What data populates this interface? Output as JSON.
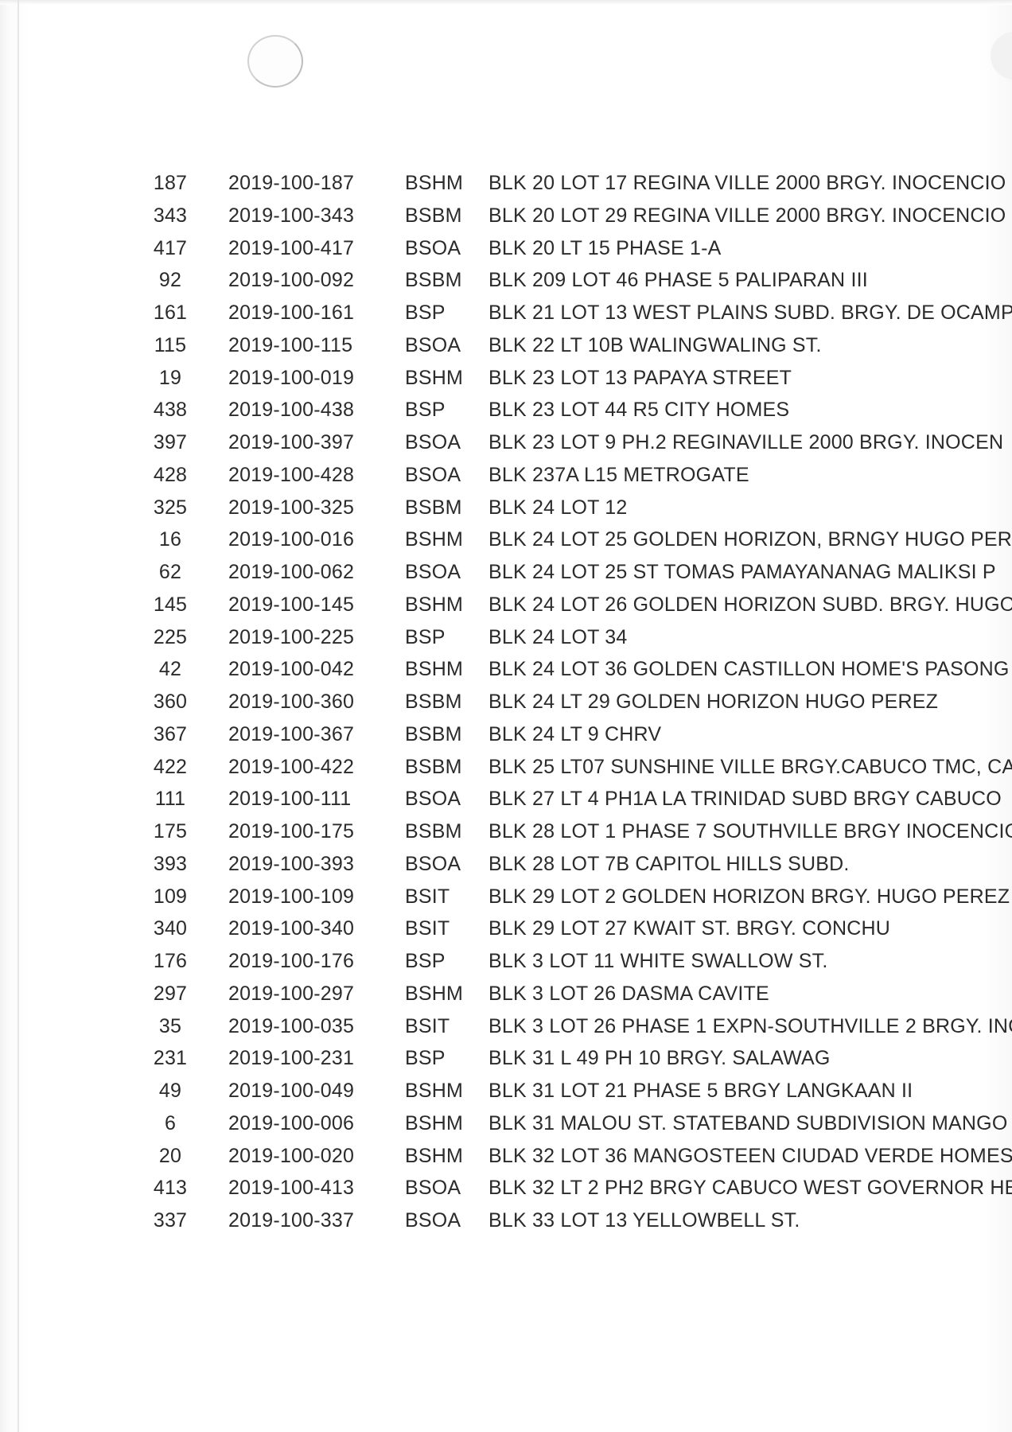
{
  "rows": [
    {
      "no": "187",
      "id": "2019-100-187",
      "program": "BSHM",
      "address": "BLK 20 LOT 17 REGINA VILLE 2000 BRGY. INOCENCIO"
    },
    {
      "no": "343",
      "id": "2019-100-343",
      "program": "BSBM",
      "address": "BLK 20 LOT 29 REGINA VILLE 2000 BRGY. INOCENCIO"
    },
    {
      "no": "417",
      "id": "2019-100-417",
      "program": "BSOA",
      "address": "BLK 20 LT 15 PHASE 1-A"
    },
    {
      "no": "92",
      "id": "2019-100-092",
      "program": "BSBM",
      "address": "BLK 209 LOT 46 PHASE 5 PALIPARAN III"
    },
    {
      "no": "161",
      "id": "2019-100-161",
      "program": "BSP",
      "address": "BLK 21 LOT 13 WEST PLAINS SUBD. BRGY. DE OCAMP"
    },
    {
      "no": "115",
      "id": "2019-100-115",
      "program": "BSOA",
      "address": "BLK 22 LT 10B WALINGWALING ST."
    },
    {
      "no": "19",
      "id": "2019-100-019",
      "program": "BSHM",
      "address": "BLK 23 LOT 13 PAPAYA STREET"
    },
    {
      "no": "438",
      "id": "2019-100-438",
      "program": "BSP",
      "address": "BLK 23 LOT 44 R5 CITY HOMES"
    },
    {
      "no": "397",
      "id": "2019-100-397",
      "program": "BSOA",
      "address": "BLK 23 LOT 9 PH.2 REGINAVILLE 2000 BRGY. INOCEN"
    },
    {
      "no": "428",
      "id": "2019-100-428",
      "program": "BSOA",
      "address": "BLK 237A L15 METROGATE"
    },
    {
      "no": "325",
      "id": "2019-100-325",
      "program": "BSBM",
      "address": "BLK 24 LOT 12"
    },
    {
      "no": "16",
      "id": "2019-100-016",
      "program": "BSHM",
      "address": "BLK 24 LOT 25 GOLDEN HORIZON, BRNGY HUGO PER"
    },
    {
      "no": "62",
      "id": "2019-100-062",
      "program": "BSOA",
      "address": "BLK 24 LOT 25 ST TOMAS PAMAYANANAG MALIKSI P"
    },
    {
      "no": "145",
      "id": "2019-100-145",
      "program": "BSHM",
      "address": "BLK 24 LOT 26 GOLDEN HORIZON SUBD. BRGY. HUGO"
    },
    {
      "no": "225",
      "id": "2019-100-225",
      "program": "BSP",
      "address": "BLK 24 LOT 34"
    },
    {
      "no": "42",
      "id": "2019-100-042",
      "program": "BSHM",
      "address": "BLK 24 LOT 36 GOLDEN CASTILLON HOME'S PASONG"
    },
    {
      "no": "360",
      "id": "2019-100-360",
      "program": "BSBM",
      "address": "BLK 24 LT 29 GOLDEN HORIZON HUGO PEREZ"
    },
    {
      "no": "367",
      "id": "2019-100-367",
      "program": "BSBM",
      "address": "BLK 24 LT 9 CHRV"
    },
    {
      "no": "422",
      "id": "2019-100-422",
      "program": "BSBM",
      "address": "BLK 25 LT07 SUNSHINE VILLE BRGY.CABUCO TMC, CA"
    },
    {
      "no": "111",
      "id": "2019-100-111",
      "program": "BSOA",
      "address": "BLK 27 LT 4 PH1A LA TRINIDAD SUBD BRGY CABUCO"
    },
    {
      "no": "175",
      "id": "2019-100-175",
      "program": "BSBM",
      "address": "BLK 28 LOT 1 PHASE 7 SOUTHVILLE BRGY INOCENCIO"
    },
    {
      "no": "393",
      "id": "2019-100-393",
      "program": "BSOA",
      "address": "BLK 28 LOT 7B CAPITOL HILLS SUBD."
    },
    {
      "no": "109",
      "id": "2019-100-109",
      "program": "BSIT",
      "address": "BLK 29 LOT 2 GOLDEN HORIZON BRGY. HUGO PEREZ"
    },
    {
      "no": "340",
      "id": "2019-100-340",
      "program": "BSIT",
      "address": "BLK 29 LOT 27 KWAIT ST. BRGY. CONCHU"
    },
    {
      "no": "176",
      "id": "2019-100-176",
      "program": "BSP",
      "address": "BLK 3 LOT 11 WHITE SWALLOW ST."
    },
    {
      "no": "297",
      "id": "2019-100-297",
      "program": "BSHM",
      "address": "BLK 3 LOT 26 DASMA CAVITE"
    },
    {
      "no": "35",
      "id": "2019-100-035",
      "program": "BSIT",
      "address": "BLK 3 LOT 26 PHASE 1 EXPN-SOUTHVILLE 2 BRGY. INC"
    },
    {
      "no": "231",
      "id": "2019-100-231",
      "program": "BSP",
      "address": "BLK 31 L 49 PH 10 BRGY. SALAWAG"
    },
    {
      "no": "49",
      "id": "2019-100-049",
      "program": "BSHM",
      "address": "BLK 31 LOT 21 PHASE 5 BRGY LANGKAAN II"
    },
    {
      "no": "6",
      "id": "2019-100-006",
      "program": "BSHM",
      "address": "BLK 31 MALOU ST. STATEBAND SUBDIVISION MANGO"
    },
    {
      "no": "20",
      "id": "2019-100-020",
      "program": "BSHM",
      "address": "BLK 32 LOT 36 MANGOSTEEN CIUDAD VERDE HOMES"
    },
    {
      "no": "413",
      "id": "2019-100-413",
      "program": "BSOA",
      "address": "BLK 32 LT 2 PH2 BRGY CABUCO WEST GOVERNOR HE"
    },
    {
      "no": "337",
      "id": "2019-100-337",
      "program": "BSOA",
      "address": "BLK 33 LOT 13 YELLOWBELL ST."
    }
  ]
}
